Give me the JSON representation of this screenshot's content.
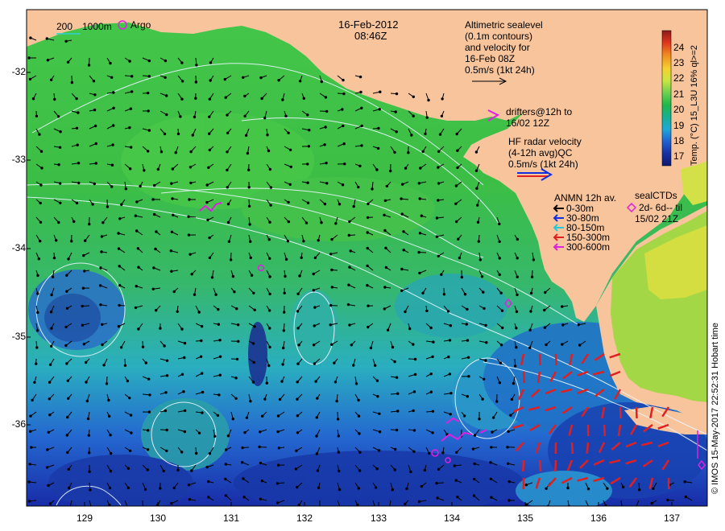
{
  "header": {
    "date": "16-Feb-2012",
    "time": "08:46Z"
  },
  "scale_bar": {
    "label_200": "200",
    "label_1000": "1000m",
    "argo_label": "Argo"
  },
  "altimetry": {
    "lines": [
      "Altimetric sealevel",
      "(0.1m contours)",
      "and velocity for",
      "16-Feb 08Z",
      "0.5m/s (1kt 24h)"
    ]
  },
  "drifters": {
    "symbol": ">",
    "lines": [
      "drifters@12h to",
      "16/02 12Z"
    ]
  },
  "hf_radar": {
    "lines": [
      "HF radar velocity",
      "(4-12h avg)QC",
      "0.5m/s (1kt 24h)"
    ]
  },
  "anmn": {
    "title": "ANMN 12h av.",
    "items": [
      {
        "label": "0-30m",
        "color": "#000000"
      },
      {
        "label": "30-80m",
        "color": "#1030e0"
      },
      {
        "label": "80-150m",
        "color": "#20c8d8"
      },
      {
        "label": "150-300m",
        "color": "#e02020"
      },
      {
        "label": "300-600m",
        "color": "#e020e0"
      }
    ]
  },
  "seal_ctds": {
    "title": "sealCTDs",
    "line1": "2d- 6d-- til",
    "line2": "15/02 21Z"
  },
  "colorbar": {
    "ticks": [
      "24",
      "23",
      "22",
      "21",
      "20",
      "19",
      "18",
      "17"
    ],
    "title": "Temp. (°C) 15_L3U 16% ql>=2",
    "colors": [
      "#8b1a1a",
      "#e0351e",
      "#f08a20",
      "#f5d030",
      "#c8e640",
      "#6ed050",
      "#20b84a",
      "#18b090",
      "#20a8d8",
      "#2060d0",
      "#1830a0",
      "#101870"
    ]
  },
  "credit": "© IMOS 15-May-2017 22:52:31 Hobart time",
  "axes": {
    "y_ticks": [
      "-32",
      "-33",
      "-34",
      "-35",
      "-36"
    ],
    "x_ticks": [
      "129",
      "130",
      "131",
      "132",
      "133",
      "134",
      "135",
      "136",
      "137"
    ]
  },
  "chart_data": {
    "type": "map",
    "lon_range": [
      128.2,
      137.5
    ],
    "lat_range": [
      -36.8,
      -31.3
    ],
    "x_ticks": [
      129,
      130,
      131,
      132,
      133,
      134,
      135,
      136,
      137
    ],
    "y_ticks": [
      -32,
      -33,
      -34,
      -35,
      -36
    ],
    "colorbar_range": [
      16.5,
      25
    ],
    "colorbar_ticks": [
      17,
      18,
      19,
      20,
      21,
      22,
      23,
      24
    ]
  },
  "colors": {
    "land": "#f8c49c",
    "sea_warm": "#3cbe48",
    "sea_mid": "#28b4b8",
    "sea_cool": "#2860d0",
    "sea_cold": "#1428a0",
    "contour": "#e8f4ff",
    "argo": "#e020e0"
  }
}
